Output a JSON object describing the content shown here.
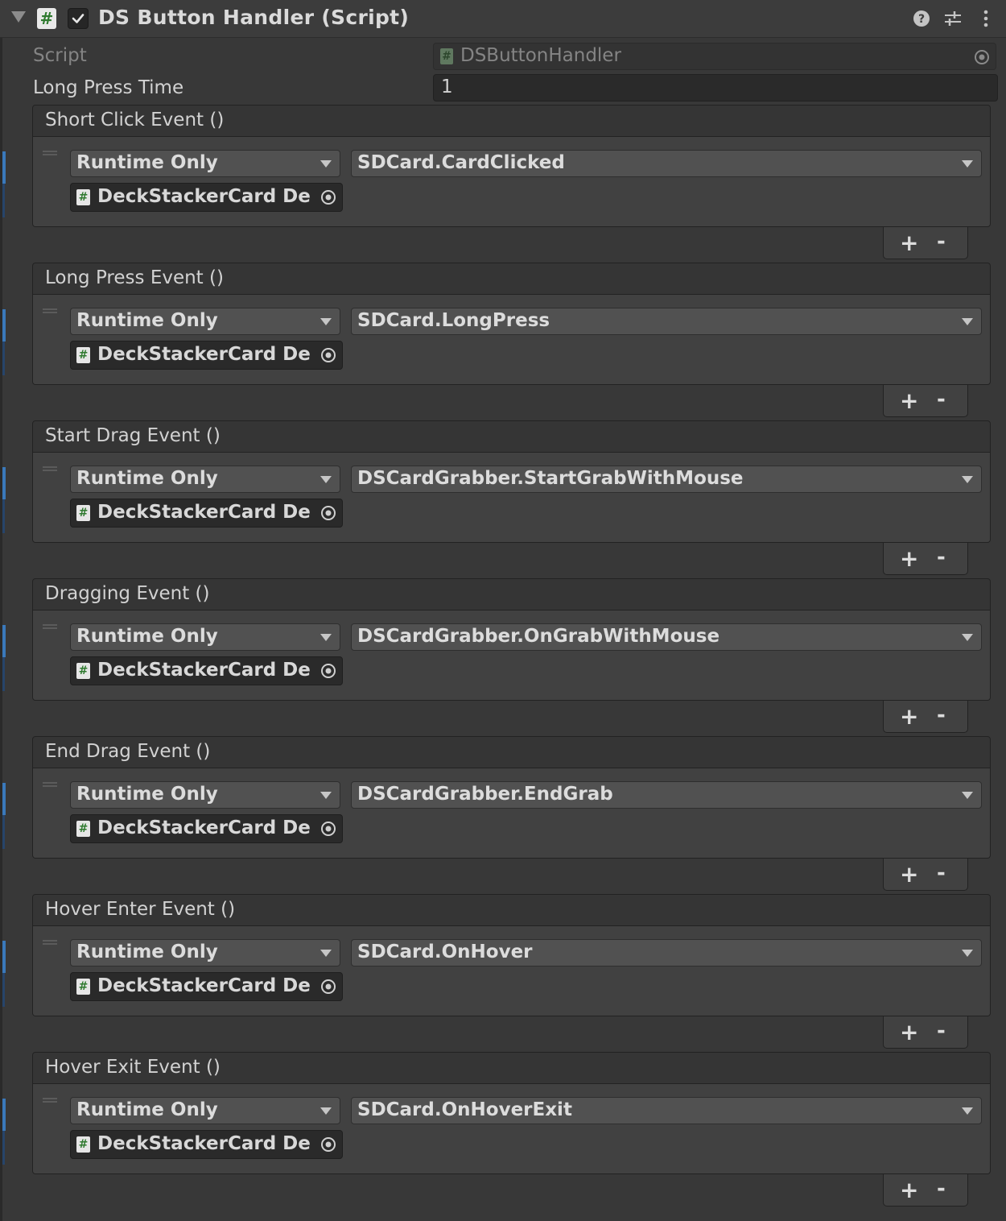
{
  "header": {
    "title": "DS Button Handler (Script)",
    "icon_glyph": "#",
    "enabled": true,
    "icons": [
      "help-icon",
      "preset-icon",
      "kebab-menu-icon"
    ]
  },
  "properties": {
    "script_label": "Script",
    "script_value": "DSButtonHandler",
    "long_press_label": "Long Press Time",
    "long_press_value": "1"
  },
  "events": [
    {
      "label": "Short Click Event ()",
      "mode": "Runtime Only",
      "function": "SDCard.CardClicked",
      "object": "DeckStackerCard Demo"
    },
    {
      "label": "Long Press Event ()",
      "mode": "Runtime Only",
      "function": "SDCard.LongPress",
      "object": "DeckStackerCard Demo"
    },
    {
      "label": "Start Drag Event ()",
      "mode": "Runtime Only",
      "function": "DSCardGrabber.StartGrabWithMouse",
      "object": "DeckStackerCard Demo"
    },
    {
      "label": "Dragging Event ()",
      "mode": "Runtime Only",
      "function": "DSCardGrabber.OnGrabWithMouse",
      "object": "DeckStackerCard Demo"
    },
    {
      "label": "End Drag Event ()",
      "mode": "Runtime Only",
      "function": "DSCardGrabber.EndGrab",
      "object": "DeckStackerCard Demo"
    },
    {
      "label": "Hover Enter Event ()",
      "mode": "Runtime Only",
      "function": "SDCard.OnHover",
      "object": "DeckStackerCard Demo"
    },
    {
      "label": "Hover Exit Event ()",
      "mode": "Runtime Only",
      "function": "SDCard.OnHoverExit",
      "object": "DeckStackerCard Demo"
    }
  ],
  "list_controls": {
    "add": "+",
    "remove": "-"
  },
  "colors": {
    "background": "#383838",
    "selection": "#3a79bb",
    "script_icon_green": "#2f7a2f"
  }
}
